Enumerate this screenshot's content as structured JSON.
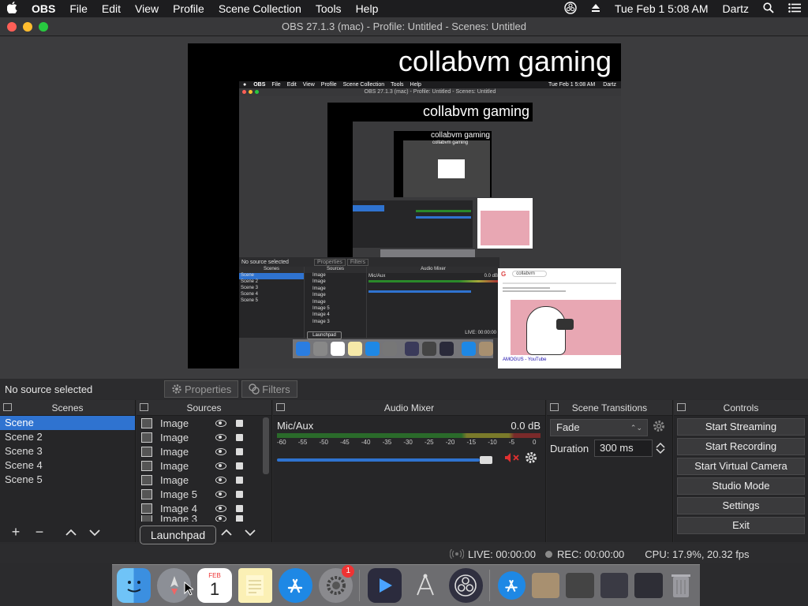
{
  "menubar": {
    "app": "OBS",
    "items": [
      "File",
      "Edit",
      "View",
      "Profile",
      "Scene Collection",
      "Tools",
      "Help"
    ],
    "clock": "Tue Feb 1  5:08 AM",
    "user": "Dartz"
  },
  "window": {
    "title": "OBS 27.1.3 (mac) - Profile: Untitled - Scenes: Untitled"
  },
  "preview": {
    "overlay_text": "collabvm gaming",
    "nested_title": "OBS 27.1.3 (mac) - Profile: Untitled - Scenes: Untitled",
    "nested_menubar": [
      "OBS",
      "File",
      "Edit",
      "View",
      "Profile",
      "Scene Collection",
      "Tools",
      "Help"
    ],
    "nested_clock": "Tue Feb 1  5:08 AM",
    "nested_user": "Dartz",
    "nested_no_source": "No source selected",
    "nested_props": "Properties",
    "nested_filters": "Filters",
    "nested_scenes": "Scenes",
    "nested_sources": "Sources",
    "nested_mixer": "Audio Mixer",
    "nested_mic": "Mic/Aux",
    "nested_db": "0.0 dB",
    "nested_live": "LIVE: 00:00:00",
    "nested_tooltip": "Launchpad",
    "nested_scene_items": [
      "Scene",
      "Scene 2",
      "Scene 3",
      "Scene 4",
      "Scene 5"
    ],
    "nested_source_items": [
      "Image",
      "Image",
      "Image",
      "Image",
      "Image",
      "Image 5",
      "Image 4",
      "Image 3"
    ],
    "browser_search": "collabvm",
    "youtube_caption": "AMOGUS - YouTube"
  },
  "properties_bar": {
    "status": "No source selected",
    "properties": "Properties",
    "filters": "Filters"
  },
  "scenes": {
    "header": "Scenes",
    "items": [
      "Scene",
      "Scene 2",
      "Scene 3",
      "Scene 4",
      "Scene 5"
    ],
    "selected": 0
  },
  "sources": {
    "header": "Sources",
    "items": [
      "Image",
      "Image",
      "Image",
      "Image",
      "Image",
      "Image 5",
      "Image 4",
      "Image 3"
    ]
  },
  "mixer": {
    "header": "Audio Mixer",
    "channel": "Mic/Aux",
    "level": "0.0 dB",
    "ticks": [
      "-60",
      "-55",
      "-50",
      "-45",
      "-40",
      "-35",
      "-30",
      "-25",
      "-20",
      "-15",
      "-10",
      "-5",
      "0"
    ],
    "volume_fraction": 0.96
  },
  "transitions": {
    "header": "Scene Transitions",
    "selected": "Fade",
    "duration_label": "Duration",
    "duration_value": "300 ms"
  },
  "controls": {
    "header": "Controls",
    "buttons": [
      "Start Streaming",
      "Start Recording",
      "Start Virtual Camera",
      "Studio Mode",
      "Settings",
      "Exit"
    ]
  },
  "status": {
    "live": "LIVE: 00:00:00",
    "rec": "REC: 00:00:00",
    "cpu": "CPU: 17.9%, 20.32 fps"
  },
  "dock": {
    "tooltip": "Launchpad",
    "calendar_month": "FEB",
    "calendar_day": "1",
    "badge": "1"
  },
  "colors": {
    "accent": "#2f73d0",
    "mute": "#e03030"
  }
}
